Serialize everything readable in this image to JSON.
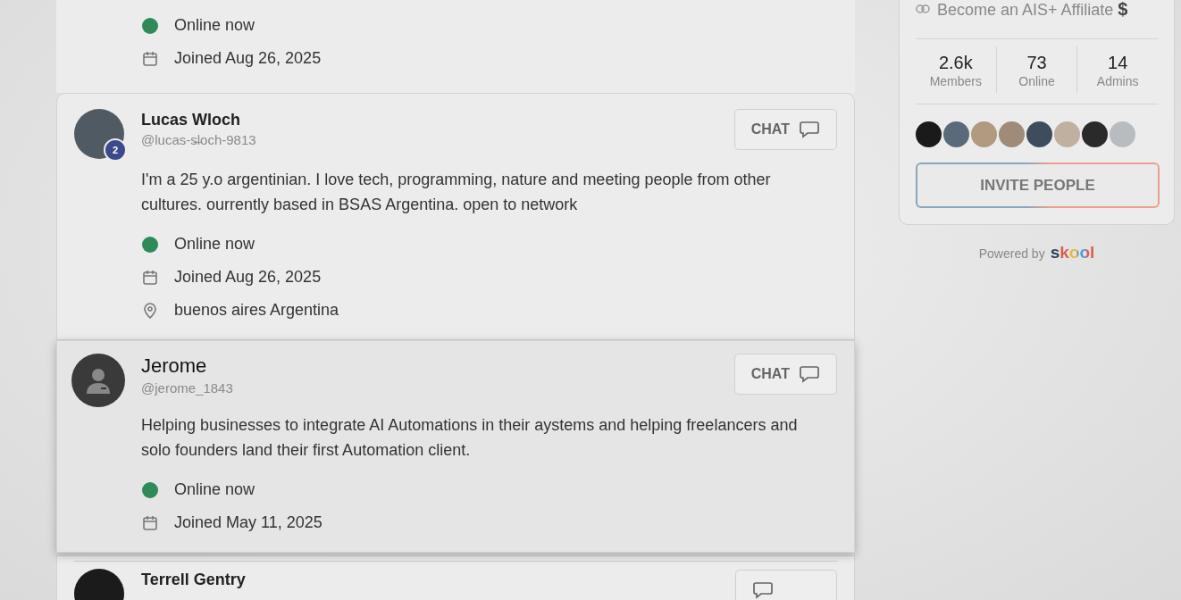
{
  "members": [
    {
      "status": {
        "online": true,
        "label": "Online now"
      },
      "joined": "Joined Aug 26, 2025",
      "hovered": false
    },
    {
      "kind": "photo",
      "badge": "2",
      "name": "Lucas Wloch",
      "handle": "@lucas-s̶loch-9813",
      "chat_button": "CHAT",
      "bio": "I'm a 25 y.o argentinian. I love tech, programming, nature and meeting people from other cultures. ourrently based in BSAS Argentina. open to network",
      "status": {
        "online": true,
        "label": "Online now"
      },
      "joined": "Joined Aug 26, 2025",
      "location": "buenos aires Argentina",
      "hovered": false
    },
    {
      "kind": "silhouette",
      "name": "Jerome",
      "handle": "@jerome_1843",
      "chat_button": "CHAT",
      "bio": "Helping businesses to integrate AI Automations in their aystems and helping freelancers and solo founders land their first Automation client.",
      "status": {
        "online": true,
        "label": "Online now"
      },
      "joined": "Joined May 11, 2025",
      "hovered": true
    },
    {
      "kind": "photo",
      "name": "Terrell Gentry",
      "hovered": false
    }
  ],
  "sidebar": {
    "affiliate_link": "Become an AIS+ Affiliate **$**",
    "stats": [
      {
        "value": "2.6k",
        "label": "Members"
      },
      {
        "value": "73",
        "label": "Online"
      },
      {
        "value": "14",
        "label": "Admins"
      }
    ],
    "invite_button": "INVITE PEOPLE",
    "powered_by": "Powered by",
    "brand": "skool"
  }
}
